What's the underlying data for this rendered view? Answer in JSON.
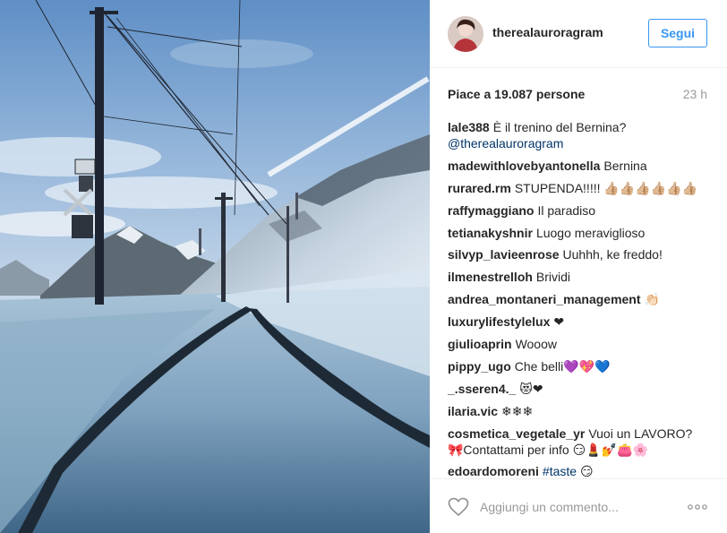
{
  "post": {
    "username": "therealauroragram",
    "follow_label": "Segui",
    "likes_text": "Piace a 19.087 persone",
    "time_ago": "23 h"
  },
  "comments": [
    {
      "user": "lale388",
      "text": "È il trenino del Bernina?",
      "mention": "@therealauroragram"
    },
    {
      "user": "madewithlovebyantonella",
      "text": "Bernina"
    },
    {
      "user": "rurared.rm",
      "text": "STUPENDA!!!!! 👍🏼👍🏼👍🏼👍🏼👍🏼👍🏼"
    },
    {
      "user": "raffymaggiano",
      "text": "Il paradiso"
    },
    {
      "user": "tetianakyshnir",
      "text": "Luogo meraviglioso"
    },
    {
      "user": "silvyp_lavieenrose",
      "text": "Uuhhh, ke freddo!"
    },
    {
      "user": "ilmenestrelloh",
      "text": "Brividi"
    },
    {
      "user": "andrea_montaneri_management",
      "text": "👏🏻"
    },
    {
      "user": "luxurylifestylelux",
      "text": "❤"
    },
    {
      "user": "giulioaprin",
      "text": "Wooow"
    },
    {
      "user": "pippy_ugo",
      "text": "Che belli💜💖💙"
    },
    {
      "user": "_.sseren4._",
      "text": "😻❤"
    },
    {
      "user": "ilaria.vic",
      "text": "❄❄❄"
    },
    {
      "user": "cosmetica_vegetale_yr",
      "text": "Vuoi un LAVORO? 🎀Contattami per info 😏💄💅👛🌸"
    },
    {
      "user": "edoardomoreni",
      "hashtag": "#taste",
      "text": "😏"
    }
  ],
  "footer": {
    "comment_placeholder": "Aggiungi un commento...",
    "heart_icon": "heart-outline-icon",
    "more_icon": "more-options-icon"
  },
  "colors": {
    "link_blue": "#3897f0",
    "mention": "#003569",
    "muted": "#999999"
  }
}
